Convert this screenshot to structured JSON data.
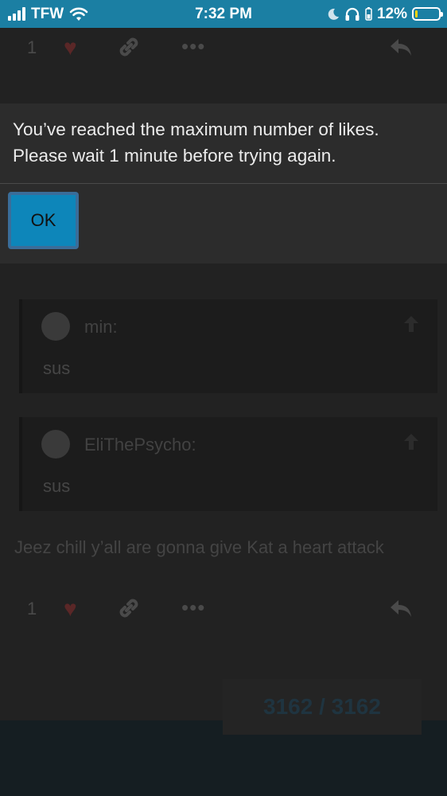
{
  "status_bar": {
    "carrier": "TFW",
    "time": "7:32 PM",
    "battery_percent": "12%",
    "battery_level": 0.12,
    "battery_color": "#ffd400",
    "background_color": "#1b7fa3",
    "icons": [
      "signal-icon",
      "wifi-icon",
      "moon-icon",
      "headphones-icon",
      "battery-icon"
    ]
  },
  "dialog": {
    "message": "You’ve reached the maximum number of likes. Please wait 1 minute before trying again.",
    "ok_label": "OK",
    "button_color": "#0d86ba"
  },
  "top_actions": {
    "like_count": "1",
    "icons": [
      "heart-icon",
      "link-icon",
      "more-icon",
      "reply-icon"
    ]
  },
  "quotes": [
    {
      "username": "min:",
      "text": "sus"
    },
    {
      "username": "EliThePsycho:",
      "text": "sus"
    }
  ],
  "post": {
    "text": "Jeez chill y’all are gonna give Kat a heart attack"
  },
  "bottom_actions": {
    "like_count": "1"
  },
  "topic_progress": {
    "text": "3162 / 3162"
  }
}
